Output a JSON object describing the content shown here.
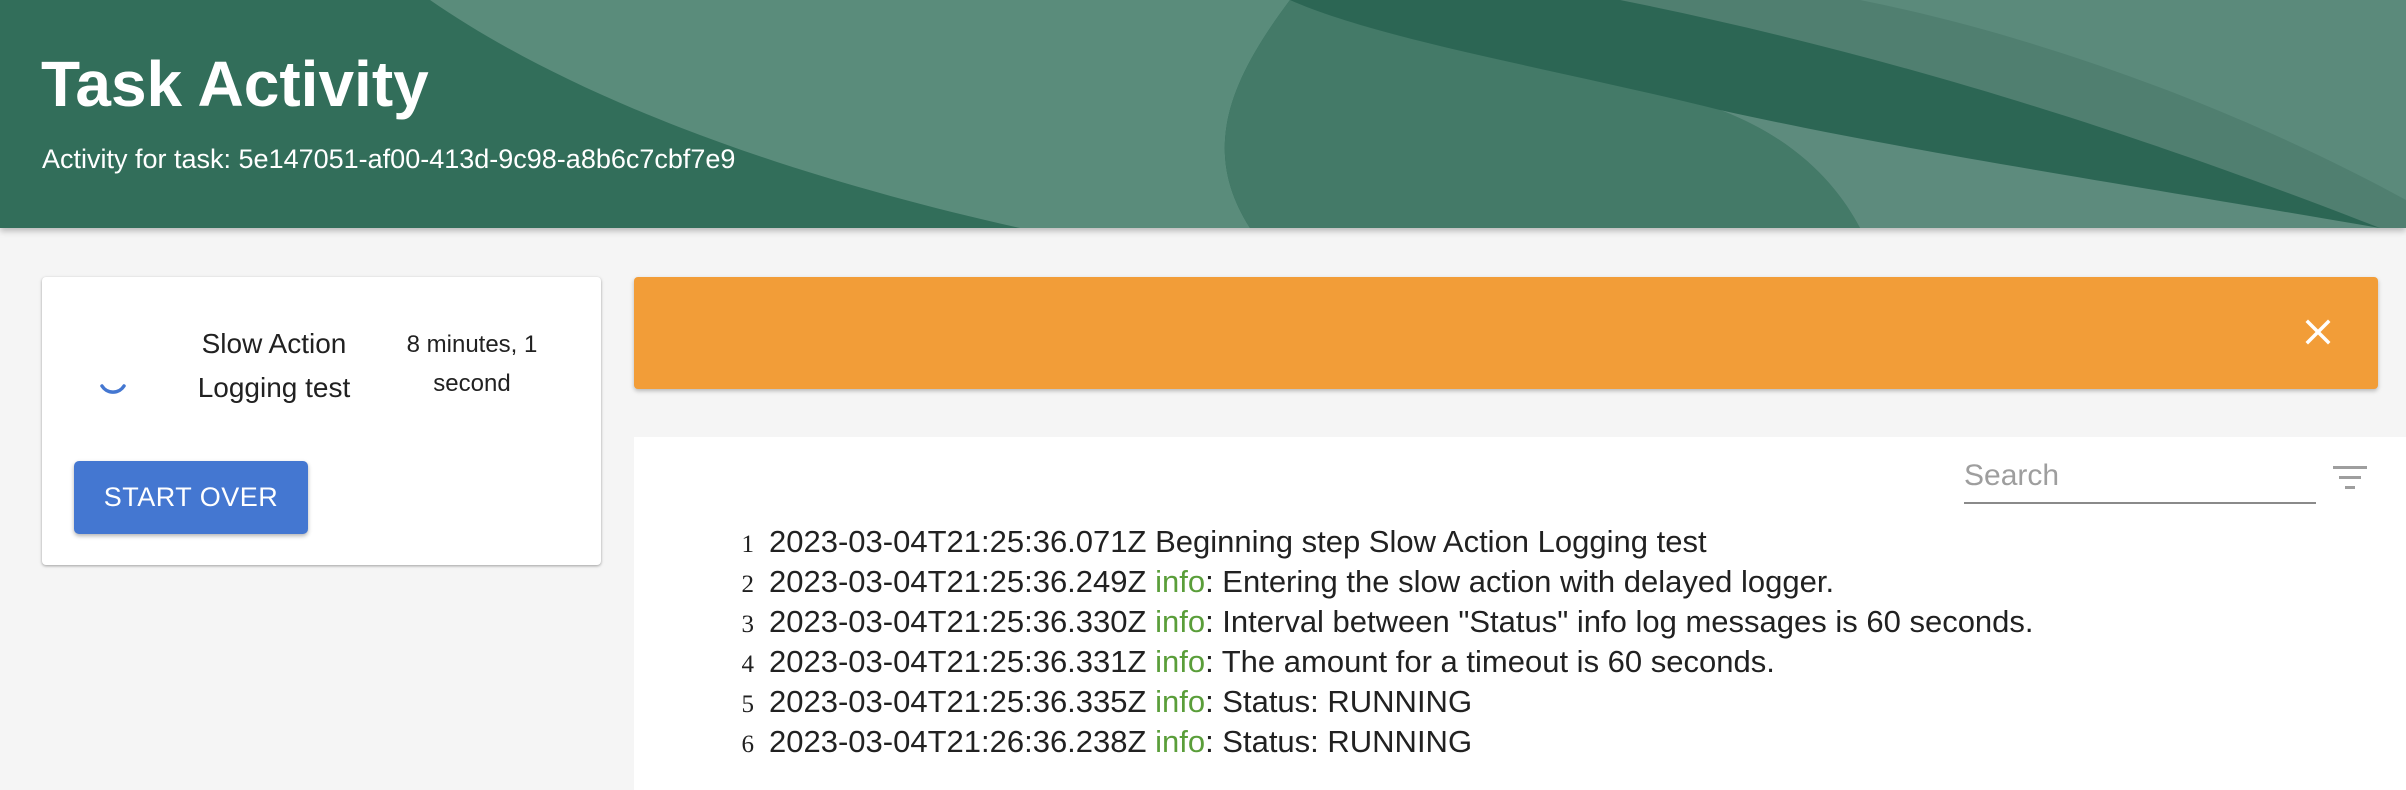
{
  "header": {
    "title": "Task Activity",
    "subtitle": "Activity for task: 5e147051-af00-413d-9c98-a8b6c7cbf7e9"
  },
  "task_card": {
    "status_icon": "spinner-icon",
    "task_name": "Slow Action Logging test",
    "duration": "8 minutes, 1 second",
    "start_over_label": "START OVER"
  },
  "alert": {
    "close_icon": "close-icon"
  },
  "log": {
    "search_placeholder": "Search",
    "filter_icon": "filter-icon",
    "lines": [
      {
        "number": "1",
        "timestamp": "2023-03-04T21:25:36.071Z",
        "level": "",
        "message": "Beginning step Slow Action Logging test"
      },
      {
        "number": "2",
        "timestamp": "2023-03-04T21:25:36.249Z",
        "level": "info",
        "message": ": Entering the slow action with delayed logger."
      },
      {
        "number": "3",
        "timestamp": "2023-03-04T21:25:36.330Z",
        "level": "info",
        "message": ": Interval between \"Status\" info log messages is 60 seconds."
      },
      {
        "number": "4",
        "timestamp": "2023-03-04T21:25:36.331Z",
        "level": "info",
        "message": ": The amount for a timeout is 60 seconds."
      },
      {
        "number": "5",
        "timestamp": "2023-03-04T21:25:36.335Z",
        "level": "info",
        "message": ": Status: RUNNING"
      },
      {
        "number": "6",
        "timestamp": "2023-03-04T21:26:36.238Z",
        "level": "info",
        "message": ": Status: RUNNING"
      }
    ]
  },
  "colors": {
    "header_green": "#2c6654",
    "alert_orange": "#f29d38",
    "button_blue": "#4477d1",
    "info_green": "#5a9e3a"
  }
}
